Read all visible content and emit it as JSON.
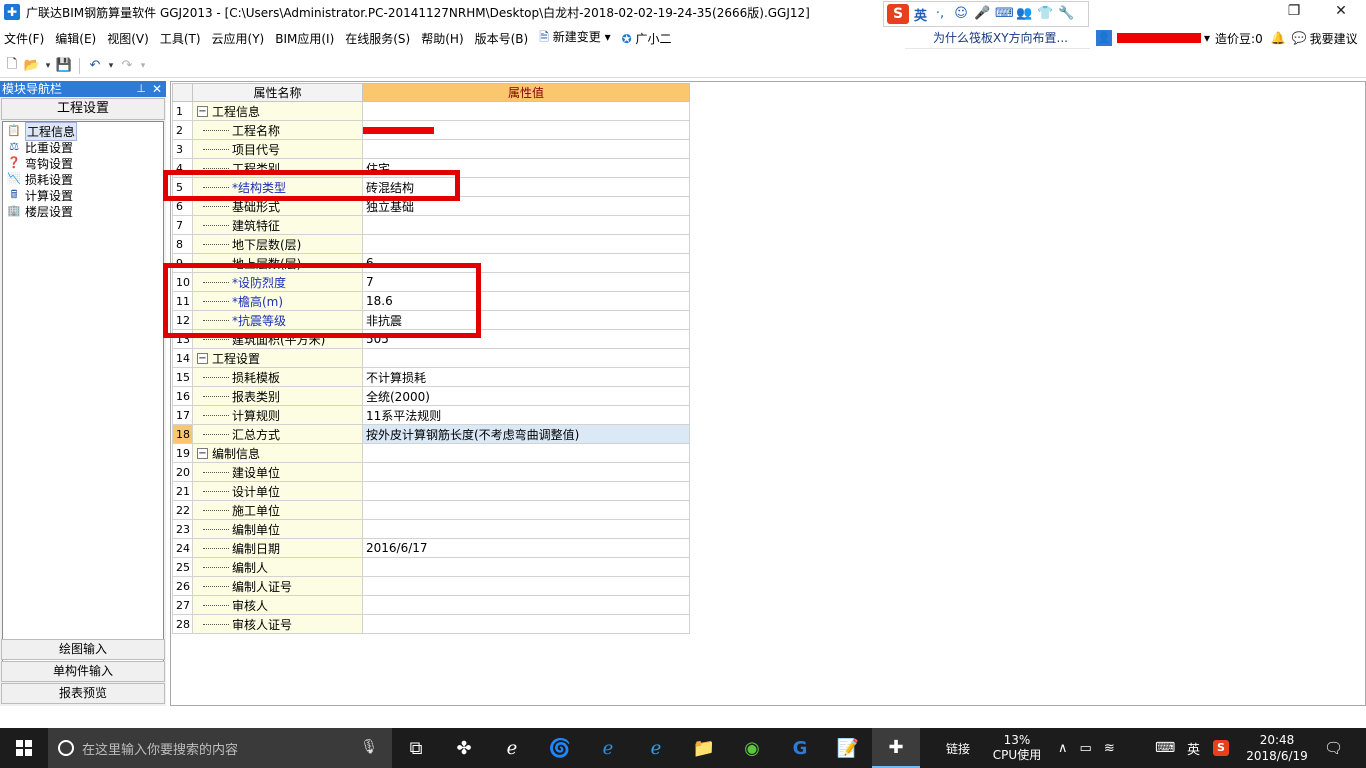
{
  "window": {
    "title": "广联达BIM钢筋算量软件 GGJ2013 - [C:\\Users\\Administrator.PC-20141127NRHM\\Desktop\\白龙村-2018-02-02-19-24-35(2666版).GGJ12]",
    "app_icon_glyph": "✚",
    "restore_glyph": "❐",
    "close_glyph": "✕"
  },
  "ime": {
    "logo": "S",
    "lang": "英"
  },
  "menu": {
    "items": [
      "文件(F)",
      "编辑(E)",
      "视图(V)",
      "工具(T)",
      "云应用(Y)",
      "BIM应用(I)",
      "在线服务(S)",
      "帮助(H)",
      "版本号(B)",
      "新建变更",
      "广小二"
    ],
    "dropdown_arrow": "▾",
    "hint": "为什么筏板XY方向布置...",
    "cost_beans": "造价豆:0",
    "suggest": "我要建议"
  },
  "nav": {
    "title": "模块导航栏",
    "pin_glyph": "⊥",
    "close_glyph": "✕",
    "group": "工程设置",
    "items": [
      {
        "label": "工程信息",
        "icon": "📋"
      },
      {
        "label": "比重设置",
        "icon": "⚖"
      },
      {
        "label": "弯钩设置",
        "icon": "❓"
      },
      {
        "label": "损耗设置",
        "icon": "📉"
      },
      {
        "label": "计算设置",
        "icon": "🖩"
      },
      {
        "label": "楼层设置",
        "icon": "🏢"
      }
    ],
    "bottom": [
      "绘图输入",
      "单构件输入",
      "报表预览"
    ]
  },
  "grid": {
    "col_name": "属性名称",
    "col_value": "属性值",
    "expander_glyph": "−",
    "rows": [
      {
        "num": "1",
        "name": "工程信息",
        "value": "",
        "group": true
      },
      {
        "num": "2",
        "name": "工程名称",
        "value": "",
        "redacted": true
      },
      {
        "num": "3",
        "name": "项目代号",
        "value": ""
      },
      {
        "num": "4",
        "name": "工程类别",
        "value": "住宅"
      },
      {
        "num": "5",
        "name": "*结构类型",
        "value": "砖混结构",
        "required": true
      },
      {
        "num": "6",
        "name": "基础形式",
        "value": "独立基础"
      },
      {
        "num": "7",
        "name": "建筑特征",
        "value": ""
      },
      {
        "num": "8",
        "name": "地下层数(层)",
        "value": ""
      },
      {
        "num": "9",
        "name": "地上层数(层)",
        "value": "6"
      },
      {
        "num": "10",
        "name": "*设防烈度",
        "value": "7",
        "required": true
      },
      {
        "num": "11",
        "name": "*檐高(m)",
        "value": "18.6",
        "required": true
      },
      {
        "num": "12",
        "name": "*抗震等级",
        "value": "非抗震",
        "required": true
      },
      {
        "num": "13",
        "name": "建筑面积(平方米)",
        "value": "505"
      },
      {
        "num": "14",
        "name": "工程设置",
        "value": "",
        "group": true
      },
      {
        "num": "15",
        "name": "损耗模板",
        "value": "不计算损耗"
      },
      {
        "num": "16",
        "name": "报表类别",
        "value": "全统(2000)"
      },
      {
        "num": "17",
        "name": "计算规则",
        "value": "11系平法规则"
      },
      {
        "num": "18",
        "name": "汇总方式",
        "value": "按外皮计算钢筋长度(不考虑弯曲调整值)",
        "selected": true
      },
      {
        "num": "19",
        "name": "编制信息",
        "value": "",
        "group": true
      },
      {
        "num": "20",
        "name": "建设单位",
        "value": ""
      },
      {
        "num": "21",
        "name": "设计单位",
        "value": ""
      },
      {
        "num": "22",
        "name": "施工单位",
        "value": ""
      },
      {
        "num": "23",
        "name": "编制单位",
        "value": ""
      },
      {
        "num": "24",
        "name": "编制日期",
        "value": "2016/6/17"
      },
      {
        "num": "25",
        "name": "编制人",
        "value": ""
      },
      {
        "num": "26",
        "name": "编制人证号",
        "value": ""
      },
      {
        "num": "27",
        "name": "审核人",
        "value": ""
      },
      {
        "num": "28",
        "name": "审核人证号",
        "value": ""
      }
    ]
  },
  "taskbar": {
    "search_placeholder": "在这里输入你要搜索的内容",
    "link": "链接",
    "cpu_percent": "13%",
    "cpu_label": "CPU使用",
    "lang": "英",
    "time": "20:48",
    "date": "2018/6/19"
  },
  "colors": {
    "accent": "#2e7ad6",
    "header_value_bg": "#fbc76e",
    "annotation_red": "#e00000"
  }
}
